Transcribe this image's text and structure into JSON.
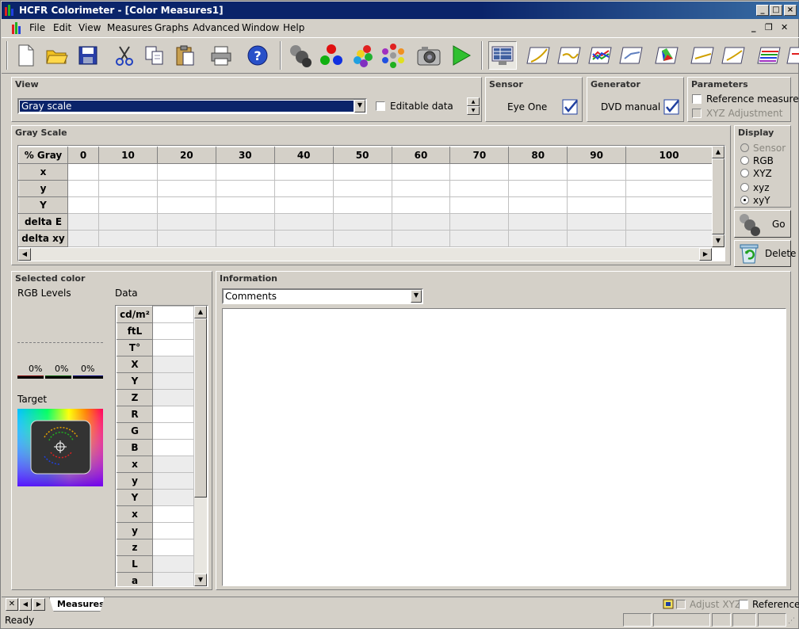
{
  "window": {
    "title": "HCFR Colorimeter - [Color Measures1]"
  },
  "menu": [
    {
      "label": "File"
    },
    {
      "label": "Edit"
    },
    {
      "label": "View"
    },
    {
      "label": "Measures"
    },
    {
      "label": "Graphs"
    },
    {
      "label": "Advanced"
    },
    {
      "label": "Window"
    },
    {
      "label": "Help"
    }
  ],
  "toolbar": {
    "icons": [
      "new-file-icon",
      "open-folder-icon",
      "save-icon",
      "cut-icon",
      "copy-icon",
      "paste-icon",
      "print-icon",
      "help-icon",
      "sensor-icon",
      "rgb-dots-icon",
      "colorful-dots-icon",
      "color-wheel-dots-icon",
      "camera-icon",
      "play-icon",
      "measures-view-icon",
      "graph-gamma-icon",
      "graph-luminance-icon",
      "graph-rgb-icon",
      "graph-delta-icon",
      "cie-chart-icon",
      "graph-saturation-icon",
      "graph-near-black-icon",
      "graph-spectrum-icon",
      "graph-extra-icon"
    ]
  },
  "view": {
    "header": "View",
    "selected": "Gray scale",
    "editable_label": "Editable data"
  },
  "sensor": {
    "header": "Sensor",
    "name": "Eye One"
  },
  "generator": {
    "header": "Generator",
    "name": "DVD manual"
  },
  "parameters": {
    "header": "Parameters",
    "reference_label": "Reference measure",
    "xyz_label": "XYZ Adjustment"
  },
  "grayscale": {
    "header": "Gray Scale",
    "columns": [
      "% Gray",
      "0",
      "10",
      "20",
      "30",
      "40",
      "50",
      "60",
      "70",
      "80",
      "90",
      "100"
    ],
    "rows": [
      "x",
      "y",
      "Y",
      "delta E",
      "delta xy"
    ]
  },
  "display": {
    "header": "Display",
    "options": [
      "Sensor",
      "RGB",
      "XYZ",
      "xyz",
      "xyY"
    ],
    "selected": "xyY",
    "go_label": "Go",
    "delete_label": "Delete"
  },
  "selected_color": {
    "header": "Selected color",
    "rgb_label": "RGB Levels",
    "data_label": "Data",
    "levels": [
      "0%",
      "0%",
      "0%"
    ],
    "target_label": "Target",
    "data_rows": [
      "cd/m²",
      "ftL",
      "T°",
      "X",
      "Y",
      "Z",
      "R",
      "G",
      "B",
      "x",
      "y",
      "Y",
      "x",
      "y",
      "z",
      "L",
      "a"
    ]
  },
  "information": {
    "header": "Information",
    "selected": "Comments"
  },
  "bottom": {
    "tab_label": "Measures",
    "adjust_label": "Adjust XYZ",
    "reference_label": "Reference",
    "status": "Ready"
  },
  "colors": {
    "title_bar": "#0a246a",
    "selection": "#0a246a",
    "face": "#d4d0c8"
  }
}
